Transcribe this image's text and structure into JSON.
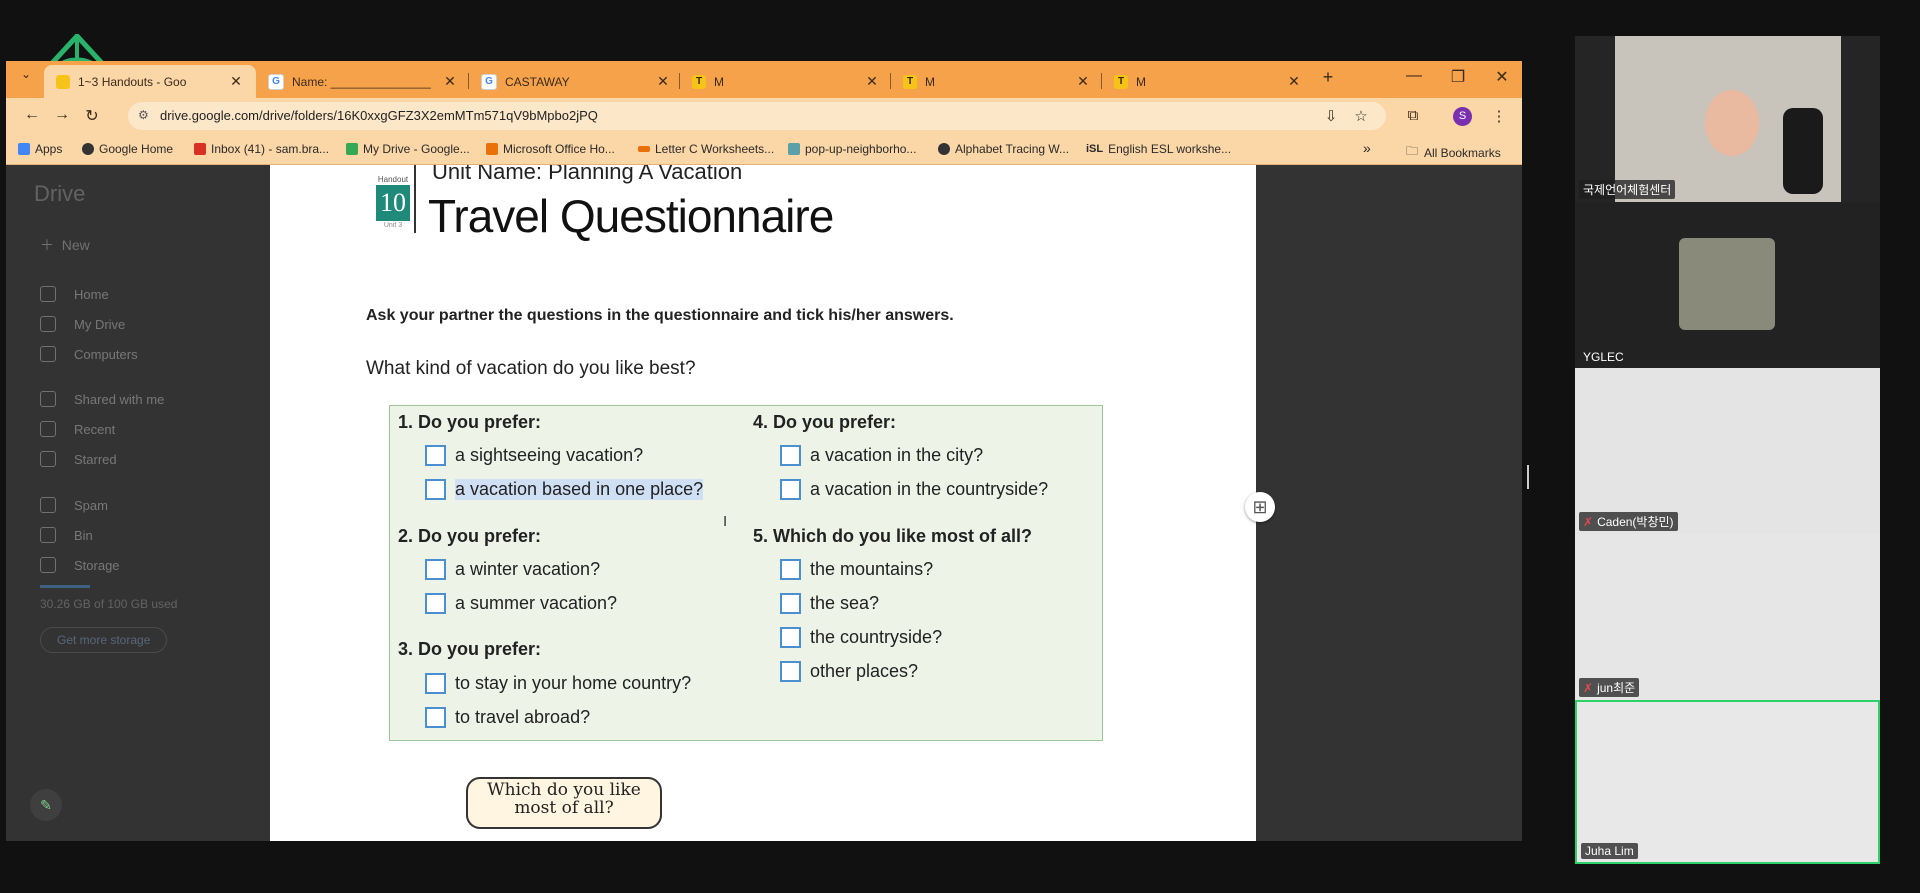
{
  "browser": {
    "tabs": [
      {
        "title": "1~3 Handouts - Goo",
        "icon": "google-drive-favicon",
        "active": true
      },
      {
        "title": "Name: _______________",
        "icon": "google-docs-favicon"
      },
      {
        "title": "CASTAWAY",
        "icon": "google-favicon"
      },
      {
        "title": "M",
        "icon": "t-favicon"
      },
      {
        "title": "M",
        "icon": "t-favicon"
      },
      {
        "title": "M",
        "icon": "t-favicon"
      }
    ],
    "url": "drive.google.com/drive/folders/16K0xxgGFZ3X2emMTm571qV9bMpbo2jPQ",
    "profile_initial": "S",
    "bookmarks": [
      {
        "label": "Apps",
        "color": "#4285f4"
      },
      {
        "label": "Google Home",
        "color": "#333333"
      },
      {
        "label": "Inbox (41) - sam.bra...",
        "color": "#d93025"
      },
      {
        "label": "My Drive - Google...",
        "color": "#34a853"
      },
      {
        "label": "Microsoft Office Ho...",
        "color": "#e8710a"
      },
      {
        "label": "Letter C Worksheets...",
        "color": "#e8710a"
      },
      {
        "label": "pop-up-neighborho...",
        "color": "#5aa0a8"
      },
      {
        "label": "Alphabet Tracing W...",
        "color": "#333333"
      },
      {
        "label": "English ESL workshe...",
        "color": "#222222",
        "prefix": "iSL"
      }
    ],
    "all_bookmarks": "All Bookmarks",
    "colors": {
      "tabbar": "#f6a24b",
      "toolbar": "#fbd6a6"
    }
  },
  "drive": {
    "app_name": "Drive",
    "new_label": "New",
    "sidebar": [
      "Home",
      "My Drive",
      "Computers",
      "Shared with me",
      "Recent",
      "Starred",
      "Spam",
      "Bin",
      "Storage"
    ],
    "storage_text": "30.26 GB of 100 GB used",
    "get_storage": "Get more storage"
  },
  "doc": {
    "handout_label": "Handout",
    "handout_number": "10",
    "unit_label": "Unit 3",
    "unit_name": "Unit Name: Planning A Vacation",
    "title": "Travel Questionnaire",
    "instruction": "Ask your partner the questions in the questionnaire and tick his/her answers.",
    "question": "What kind of vacation do you like best?",
    "items": [
      {
        "heading": "1.  Do you prefer:",
        "options": [
          "a sightseeing vacation?",
          "a vacation based in one place?"
        ]
      },
      {
        "heading": "2.  Do you prefer:",
        "options": [
          "a winter vacation?",
          "a summer vacation?"
        ]
      },
      {
        "heading": "3.  Do you prefer:",
        "options": [
          "to stay in your home country?",
          "to travel abroad?"
        ]
      },
      {
        "heading": "4. Do you prefer:",
        "options": [
          "a vacation in the city?",
          "a vacation in the countryside?"
        ]
      },
      {
        "heading": "5. Which do you like most of all?",
        "options": [
          "the mountains?",
          "the sea?",
          "the countryside?",
          "other places?"
        ]
      }
    ],
    "speech_bubble": "Which do you like most of all?"
  },
  "participants": [
    {
      "name": "국제언어체험센터",
      "muted": false
    },
    {
      "name": "YGLEC",
      "muted": false
    },
    {
      "name": "Caden(박창민)",
      "muted": true
    },
    {
      "name": "jun최준",
      "muted": true
    },
    {
      "name": "Juha Lim",
      "muted": false,
      "active_speaker": true
    }
  ]
}
